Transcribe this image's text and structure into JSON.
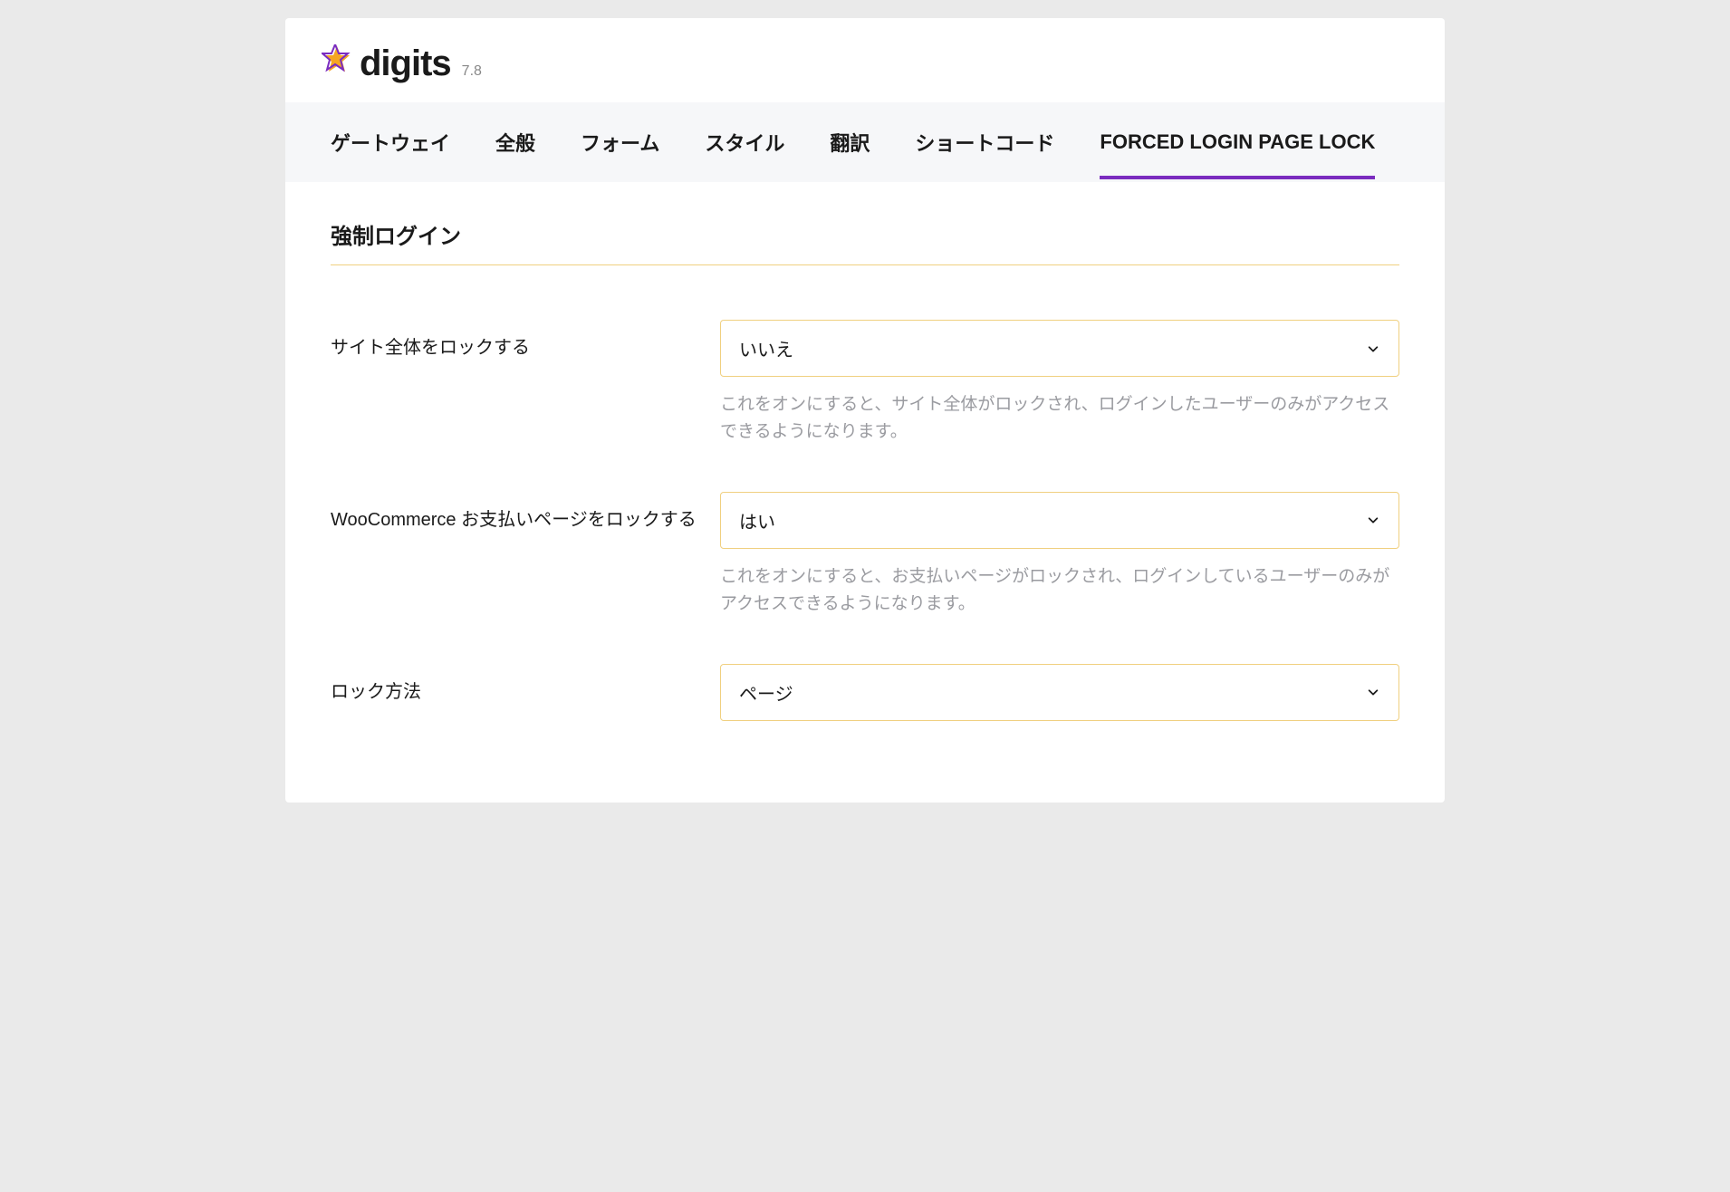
{
  "header": {
    "brand": "digits",
    "version": "7.8"
  },
  "tabs": [
    {
      "label": "ゲートウェイ",
      "active": false
    },
    {
      "label": "全般",
      "active": false
    },
    {
      "label": "フォーム",
      "active": false
    },
    {
      "label": "スタイル",
      "active": false
    },
    {
      "label": "翻訳",
      "active": false
    },
    {
      "label": "ショートコード",
      "active": false
    },
    {
      "label": "FORCED LOGIN PAGE LOCK",
      "active": true
    }
  ],
  "section": {
    "title": "強制ログイン"
  },
  "fields": {
    "lock_site": {
      "label": "サイト全体をロックする",
      "value": "いいえ",
      "description": "これをオンにすると、サイト全体がロックされ、ログインしたユーザーのみがアクセスできるようになります。"
    },
    "lock_woocommerce": {
      "label": "WooCommerce お支払いページをロックする",
      "value": "はい",
      "description": "これをオンにすると、お支払いページがロックされ、ログインしているユーザーのみがアクセスできるようになります。"
    },
    "lock_method": {
      "label": "ロック方法",
      "value": "ページ"
    }
  }
}
